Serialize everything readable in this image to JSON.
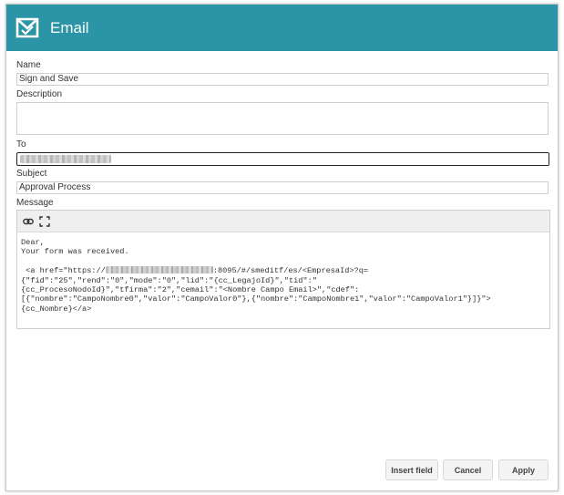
{
  "window": {
    "title": "Email",
    "icon": "envelope-check-icon"
  },
  "form": {
    "name_label": "Name",
    "name_value": "Sign and Save",
    "description_label": "Description",
    "description_value": "",
    "to_label": "To",
    "subject_label": "Subject",
    "subject_value": "Approval Process",
    "message_label": "Message"
  },
  "editor": {
    "toolbar": [
      {
        "name": "link-icon"
      },
      {
        "name": "fullscreen-icon"
      }
    ],
    "lines": [
      {
        "text": "Dear,"
      },
      {
        "text": "Your form was received."
      },
      {
        "text": ""
      },
      {
        "prefix": " <a href=\"https://",
        "suffix": ":8095/#/smeditf/es/<EmpresaId>?q="
      },
      {
        "text": "{\"fid\":\"25\",\"rend\":\"0\",\"mode\":\"0\",\"lid\":\"{cc_LegajoId}\",\"tid\":\""
      },
      {
        "text": "{cc_ProcesoNodoId}\",\"tfirma\":\"2\",\"cemail\":\"<Nombre Campo Email>\",\"cdef\":"
      },
      {
        "text": "[{\"nombre\":\"CampoNombre0\",\"valor\":\"CampoValor0\"},{\"nombre\":\"CampoNombre1\",\"valor\":\"CampoValor1\"}]}\">"
      },
      {
        "text": "{cc_Nombre}</a>"
      }
    ]
  },
  "buttons": {
    "insert_field": "Insert field",
    "cancel": "Cancel",
    "apply": "Apply"
  },
  "colors": {
    "header": "#2b94a6",
    "header_text": "#ffffff"
  }
}
